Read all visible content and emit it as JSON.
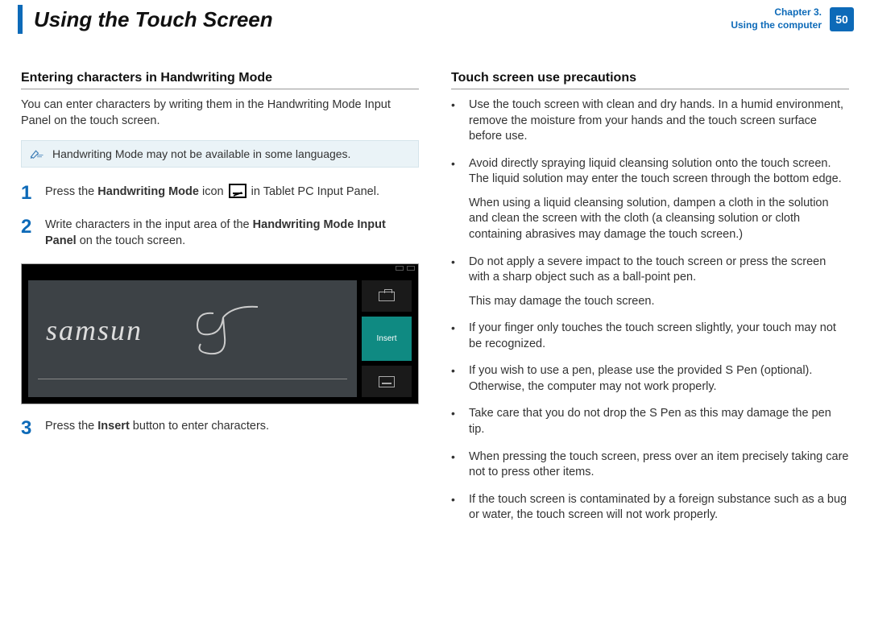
{
  "header": {
    "title": "Using the Touch Screen",
    "chapter_line1": "Chapter 3.",
    "chapter_line2": "Using the computer",
    "page_number": "50"
  },
  "left": {
    "heading": "Entering characters in Handwriting Mode",
    "intro": "You can enter characters by writing them in the Handwriting Mode Input Panel on the touch screen.",
    "note": "Handwriting Mode may not be available in some languages.",
    "step1_pre": "Press the ",
    "step1_bold": "Handwriting Mode",
    "step1_mid": " icon ",
    "step1_post": " in Tablet PC Input Panel.",
    "step2_pre": "Write characters in the input area of the ",
    "step2_bold": "Handwriting Mode Input Panel",
    "step2_post": " on the touch screen.",
    "handwriting_sample": "samsun",
    "insert_label": "Insert",
    "step3_pre": "Press the ",
    "step3_bold": "Insert",
    "step3_post": " button to enter characters.",
    "num1": "1",
    "num2": "2",
    "num3": "3"
  },
  "right": {
    "heading": "Touch screen use precautions",
    "items": [
      {
        "p1": "Use the touch screen with clean and dry hands. In a humid environment, remove the moisture from your hands and the touch screen surface before use."
      },
      {
        "p1": "Avoid directly spraying liquid cleansing solution onto the touch screen. The liquid solution may enter the touch screen through the bottom edge.",
        "p2": "When using a liquid cleansing solution, dampen a cloth in the solution and clean the screen with the cloth (a cleansing solution or cloth containing abrasives may damage the touch screen.)"
      },
      {
        "p1": "Do not apply a severe impact to the touch screen or press the screen with a sharp object such as a ball-point pen.",
        "p2": "This may damage the touch screen."
      },
      {
        "p1": "If your finger only touches the touch screen slightly, your touch may not be recognized."
      },
      {
        "p1": "If you wish to use a pen, please use the provided S Pen (optional). Otherwise, the computer may not work properly."
      },
      {
        "p1": "Take care that you do not drop the S Pen as this may damage the pen tip."
      },
      {
        "p1": "When pressing the touch screen, press over an item precisely taking care not to press other items."
      },
      {
        "p1": "If the touch screen is contaminated by a foreign substance such as a bug or water, the touch screen will not work properly."
      }
    ]
  }
}
